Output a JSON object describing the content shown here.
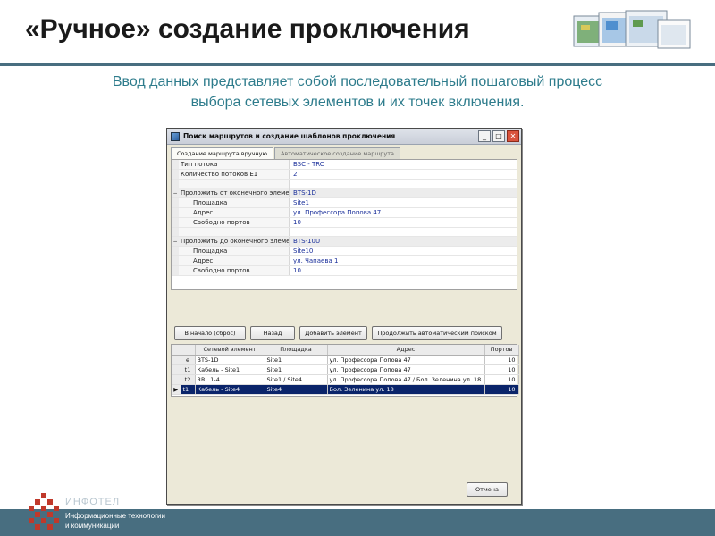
{
  "slide": {
    "title": "«Ручное» создание проключения",
    "subtitle_line1": "Ввод данных представляет собой последовательный пошаговый процесс",
    "subtitle_line2": "выбора сетевых элементов и их точек включения"
  },
  "window": {
    "title": "Поиск маршрутов и создание шаблонов проключения",
    "controls": {
      "minimize": "_",
      "maximize": "□",
      "close": "✕"
    },
    "tabs": [
      {
        "label": "Создание маршрута вручную",
        "active": true
      },
      {
        "label": "Автоматическое создание маршрута",
        "active": false
      }
    ],
    "properties": {
      "stream_type": {
        "label": "Тип потока",
        "value": "BSC - TRC"
      },
      "stream_count": {
        "label": "Количество потоков E1",
        "value": "2"
      },
      "from_group": {
        "toggle": "−",
        "label": "Проложить от оконечного элемент",
        "value": "BTS-1D"
      },
      "from_site": {
        "label": "Площадка",
        "value": "Site1"
      },
      "from_address": {
        "label": "Адрес",
        "value": "ул. Профессора Попова 47"
      },
      "from_free_ports": {
        "label": "Свободно портов",
        "value": "10"
      },
      "to_group": {
        "toggle": "−",
        "label": "Проложить до оконечного элемент",
        "value": "BTS-10U"
      },
      "to_site": {
        "label": "Площадка",
        "value": "Site10"
      },
      "to_address": {
        "label": "Адрес",
        "value": "ул. Чапаева 1"
      },
      "to_free_ports": {
        "label": "Свободно портов",
        "value": "10"
      }
    },
    "buttons": {
      "back_to_start": "В начало (сброс)",
      "back": "Назад",
      "add_element": "Добавить элемент",
      "continue_auto": "Продолжить автоматическим поиском",
      "cancel": "Отмена"
    },
    "grid": {
      "columns": [
        "Сетевой элемент",
        "Площадка",
        "Адрес",
        "Портов"
      ],
      "rows": [
        {
          "marker": "",
          "type": "e",
          "element": "BTS-1D",
          "site": "Site1",
          "address": "ул. Профессора Попова 47",
          "ports": "10"
        },
        {
          "marker": "",
          "type": "t1",
          "element": "Кабель - Site1",
          "site": "Site1",
          "address": "ул. Профессора Попова 47",
          "ports": "10"
        },
        {
          "marker": "",
          "type": "t2",
          "element": "RRL 1-4",
          "site": "Site1  /  Site4",
          "address": "ул. Профессора Попова 47  /  Бол. Зеленина ул. 18",
          "ports": "10"
        },
        {
          "marker": "▶",
          "type": "t1",
          "element": "Кабель - Site4",
          "site": "Site4",
          "address": "Бол. Зеленина ул. 18",
          "ports": "10"
        }
      ]
    }
  },
  "footer": {
    "brand_name": "ИНФОТЕЛ",
    "tagline_line1": "Информационные технологии",
    "tagline_line2": "и коммуникации"
  },
  "colors": {
    "accent_bar": "#486e80",
    "subtitle": "#2e7c8c",
    "selection": "#0a246a",
    "logo": "#c0392b"
  }
}
